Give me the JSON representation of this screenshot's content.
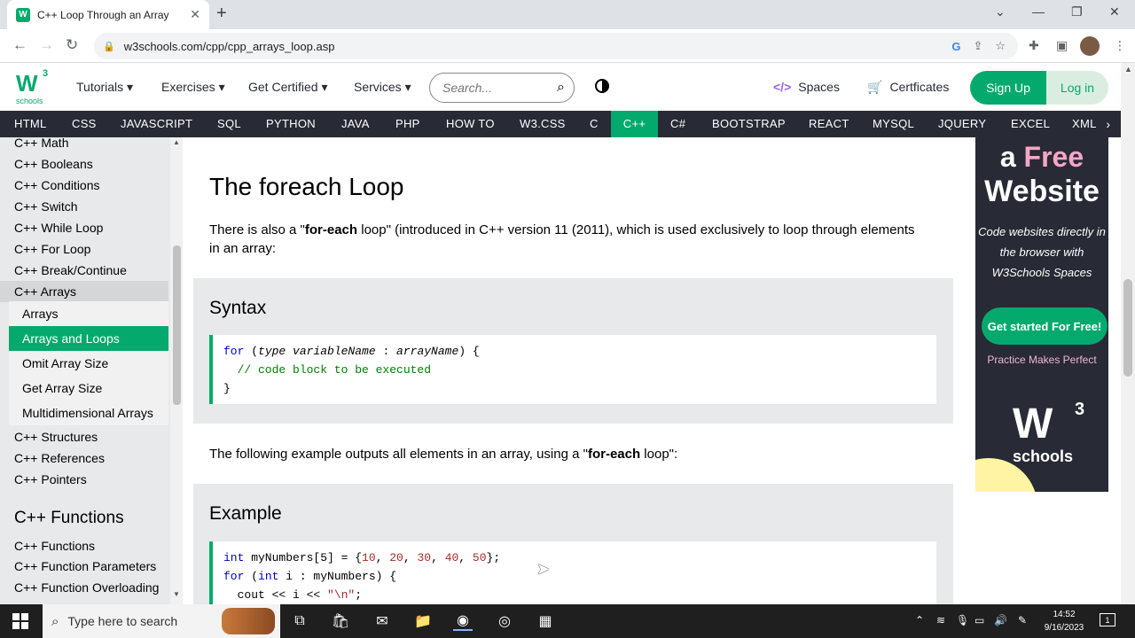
{
  "browser": {
    "tab_title": "C++ Loop Through an Array",
    "tab_favicon": "W",
    "url": "w3schools.com/cpp/cpp_arrays_loop.asp"
  },
  "header": {
    "logo_w": "W",
    "logo_sup": "3",
    "logo_sub": "schools",
    "menus": [
      "Tutorials ▾",
      "Exercises ▾",
      "Get Certified ▾",
      "Services ▾"
    ],
    "search_placeholder": "Search...",
    "spaces": "Spaces",
    "certificates": "Certficates",
    "signup": "Sign Up",
    "login": "Log in"
  },
  "topnav": {
    "items": [
      "HTML",
      "CSS",
      "JAVASCRIPT",
      "SQL",
      "PYTHON",
      "JAVA",
      "PHP",
      "HOW TO",
      "W3.CSS",
      "C",
      "C++",
      "C#",
      "BOOTSTRAP",
      "REACT",
      "MYSQL",
      "JQUERY",
      "EXCEL",
      "XML"
    ],
    "active": "C++"
  },
  "sidebar": {
    "items_top": [
      "C++ Math",
      "C++ Booleans",
      "C++ Conditions",
      "C++ Switch",
      "C++ While Loop",
      "C++ For Loop",
      "C++ Break/Continue",
      "C++ Arrays"
    ],
    "sub_items": [
      "Arrays",
      "Arrays and Loops",
      "Omit Array Size",
      "Get Array Size",
      "Multidimensional Arrays"
    ],
    "active_sub": "Arrays and Loops",
    "items_bottom": [
      "C++ Structures",
      "C++ References",
      "C++ Pointers"
    ],
    "section_heading": "C++ Functions",
    "section_items": [
      "C++ Functions",
      "C++ Function Parameters",
      "C++ Function Overloading"
    ]
  },
  "main": {
    "heading": "The foreach Loop",
    "intro_pre": "There is also a \"",
    "intro_bold1": "for-each",
    "intro_mid": " loop\" (introduced in C++ version 11 (2011), which is used exclusively to loop through elements in an array:",
    "syntax_heading": "Syntax",
    "syntax_lines": {
      "l1_kw": "for",
      "l1_a": " (",
      "l1_type": "type variableName",
      "l1_b": " : ",
      "l1_arr": "arrayName",
      "l1_c": ") {",
      "l2": "  // code block to be executed",
      "l3": "}"
    },
    "example_intro_pre": "The following example outputs all elements in an array, using a \"",
    "example_intro_bold": "for-each",
    "example_intro_post": " loop\":",
    "example_heading": "Example",
    "example_lines": {
      "l1_kw": "int",
      "l1_a": " myNumbers[5] = {",
      "n1": "10",
      "n2": "20",
      "n3": "30",
      "n4": "40",
      "n5": "50",
      "l1_end": "};",
      "l2_kw": "for",
      "l2_a": " (",
      "l2_kw2": "int",
      "l2_b": " i : myNumbers) {",
      "l3_a": "  cout << i << ",
      "l3_str": "\"\\n\"",
      "l3_end": ";"
    }
  },
  "ad": {
    "line1": "a ",
    "line1_free": "Free",
    "line2": "Website",
    "desc": [
      "Code websites directly in",
      "the browser with",
      "W3Schools Spaces"
    ],
    "cta": "Get started For Free!",
    "tagline": "Practice Makes Perfect",
    "logo_w": "W",
    "logo_3": "3",
    "logo_schools": "schools"
  },
  "taskbar": {
    "search_text": "Type here to search",
    "time": "14:52",
    "date": "9/16/2023",
    "notification_count": "1"
  },
  "colors": {
    "accent": "#04aa6d",
    "nav_dark": "#282a35",
    "sidebar_bg": "#e7e9eb"
  }
}
